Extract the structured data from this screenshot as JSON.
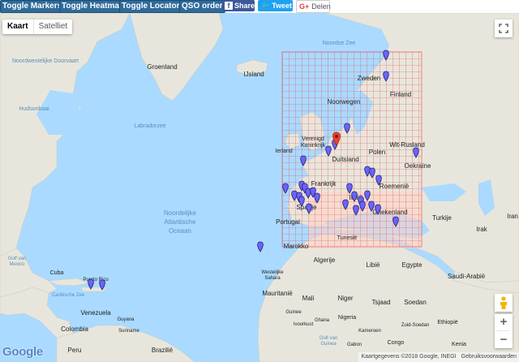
{
  "toolbar": {
    "toggle_markers": "Toggle Markers",
    "toggle_heatmap": "Toggle Heatmap",
    "toggle_locators": "Toggle Locators",
    "qso_order": "QSO order",
    "share": "Share",
    "tweet": "Tweet",
    "delen": "Delen",
    "colors": {
      "button": "#2f6b9a",
      "facebook": "#3b5998",
      "twitter": "#1da1f2"
    }
  },
  "map": {
    "map_type": {
      "map": "Kaart",
      "satellite": "Satelliet"
    },
    "fullscreen_icon": "fullscreen-icon",
    "pegman_icon": "pegman-icon",
    "zoom_in": "+",
    "zoom_out": "−",
    "logo": "Google",
    "footer": {
      "attribution": "Kaartgegevens ©2018 Google, INEGI",
      "terms": "Gebruiksvoorwaarden"
    },
    "colors": {
      "water": "#aadaff",
      "land": "#e8e6dc",
      "grid": "#e8484d",
      "heat": "#ffd7c8",
      "marker": "#6b63ff",
      "home_marker": "#ea4335"
    },
    "labels": {
      "noordse_zee": "Noordse Zee",
      "noordwestelijke_doorvaart": "Noordwestelijke Doorvaart",
      "groenland": "Groenland",
      "ijsland": "IJsland",
      "zweden": "Zweden",
      "finland": "Finland",
      "noorwegen": "Noorwegen",
      "hudsonbaai": "Hudsonbaai",
      "labradorzee": "Labradorzee",
      "verenigd_koninkrijk_1": "Verenigd",
      "verenigd_koninkrijk_2": "Koninkrijk",
      "ierland": "Ierland",
      "duitsland": "Duitsland",
      "polen": "Polen",
      "wit_rusland": "Wit-Rusland",
      "oekraine": "Oekraïne",
      "frankrijk": "Frankrijk",
      "roemenie": "Roemenië",
      "spanje": "Spanje",
      "portugal": "Portugal",
      "italie": "Italië",
      "griekenland": "Griekenland",
      "turkije": "Turkije",
      "tunesie": "Tunesië",
      "marokko": "Marokko",
      "algerije": "Algerije",
      "libie": "Libië",
      "egypte": "Egypte",
      "irak": "Irak",
      "iran": "Iran",
      "saudi_arabie": "Saudi-Arabië",
      "mauritanie": "Mauritanië",
      "mali": "Mali",
      "niger": "Niger",
      "soedan": "Soedan",
      "tsjaad": "Tsjaad",
      "westelijke_sahara_1": "Westelijke",
      "westelijke_sahara_2": "Sahara",
      "noordelijke_1": "Noordelijke",
      "noordelijke_2": "Atlantische",
      "noordelijke_3": "Oceaan",
      "golf_van_mexico_1": "Golf van",
      "golf_van_mexico_2": "Mexico",
      "cuba": "Cuba",
      "puerto_rico": "Puerto Rico",
      "caribische_zee": "Caribische Zee",
      "venezuela": "Venezuela",
      "colombia": "Colombia",
      "guyana": "Guyana",
      "suriname": "Suriname",
      "peru": "Peru",
      "brazilie": "Brazilië",
      "nigeria": "Nigeria",
      "ethiopie": "Ethiopië",
      "golf_van_guinea_1": "Golf van",
      "golf_van_guinea_2": "Guinea",
      "gabon": "Gabon",
      "congo": "Congo",
      "kenia": "Kenia",
      "zuid_soedan": "Zuid-Soedan",
      "kameroen": "Kameroen",
      "ghana": "Ghana",
      "guinee": "Guinee",
      "ivoorkust": "Ivoorkust"
    }
  }
}
